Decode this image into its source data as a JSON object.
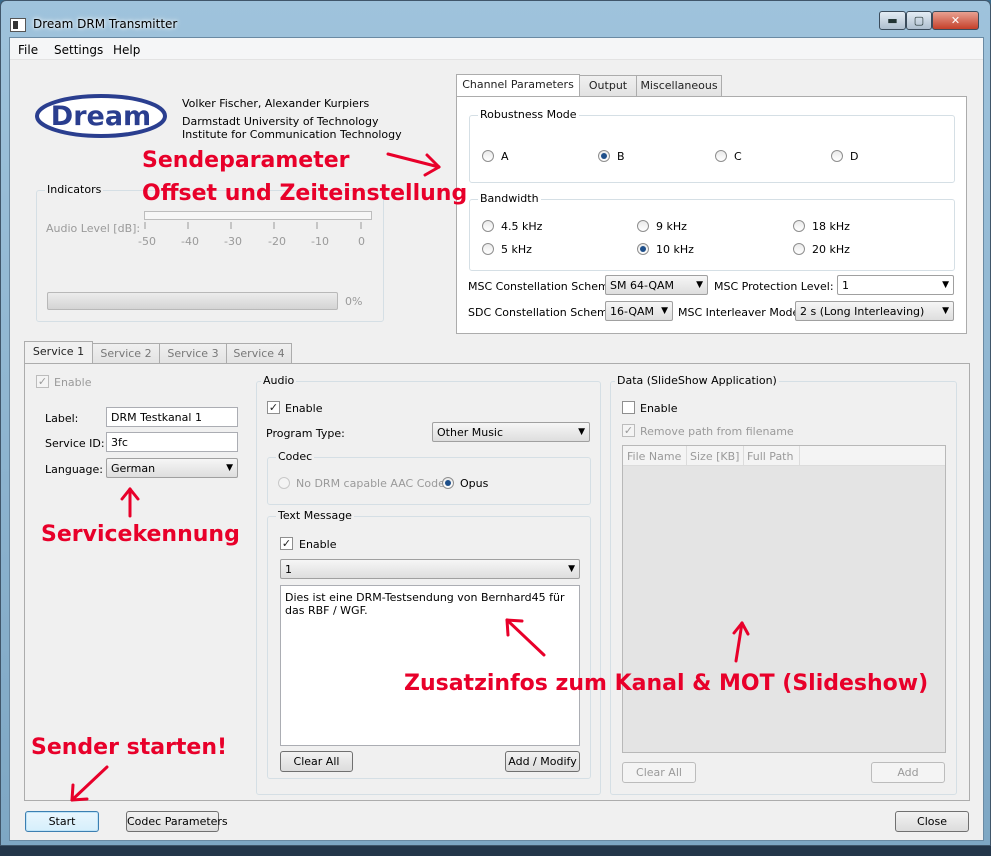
{
  "window": {
    "title": "Dream DRM Transmitter",
    "min": "▬",
    "max": "▢",
    "close": "✕"
  },
  "menu": [
    "File",
    "Settings",
    "Help"
  ],
  "header": {
    "logo": "Dream",
    "authors": "Volker Fischer, Alexander Kurpiers",
    "org1": "Darmstadt University of Technology",
    "org2": "Institute for Communication Technology"
  },
  "indicators": {
    "title": "Indicators",
    "audio_level_label": "Audio Level [dB]:",
    "scale": [
      "-50",
      "-40",
      "-30",
      "-20",
      "-10",
      "0"
    ],
    "progress_value": 0,
    "progress_text": "0%"
  },
  "channel_tabs": [
    "Channel Parameters",
    "Output",
    "Miscellaneous"
  ],
  "robustness": {
    "title": "Robustness Mode",
    "options": [
      "A",
      "B",
      "C",
      "D"
    ],
    "selected": "B"
  },
  "bandwidth": {
    "title": "Bandwidth",
    "options": [
      "4.5 kHz",
      "9 kHz",
      "18 kHz",
      "5 kHz",
      "10 kHz",
      "20 kHz"
    ],
    "selected": "10 kHz"
  },
  "params": {
    "msc_const_label": "MSC Constellation Scheme:",
    "msc_const_value": "SM 64-QAM",
    "msc_prot_label": "MSC Protection Level:",
    "msc_prot_value": "1",
    "sdc_const_label": "SDC Constellation Scheme:",
    "sdc_const_value": "16-QAM",
    "msc_inter_label": "MSC Interleaver Mode:",
    "msc_inter_value": "2 s (Long Interleaving)"
  },
  "service_tabs": [
    "Service 1",
    "Service 2",
    "Service 3",
    "Service 4"
  ],
  "service": {
    "enable_label": "Enable",
    "label_label": "Label:",
    "label_value": "DRM Testkanal 1",
    "id_label": "Service ID:",
    "id_value": "3fc",
    "lang_label": "Language:",
    "lang_value": "German"
  },
  "audio": {
    "title": "Audio",
    "enable_label": "Enable",
    "program_type_label": "Program Type:",
    "program_type_value": "Other Music",
    "codec_title": "Codec",
    "codec_opt1": "No DRM capable AAC Codec",
    "codec_opt2": "Opus",
    "text_title": "Text Message",
    "text_enable_label": "Enable",
    "text_select": "1",
    "text_message": "Dies ist eine DRM-Testsendung von Bernhard45 für das RBF / WGF.",
    "clear_all": "Clear All",
    "add_modify": "Add / Modify"
  },
  "data": {
    "title": "Data (SlideShow Application)",
    "enable_label": "Enable",
    "remove_path_label": "Remove path from filename",
    "columns": [
      "File Name",
      "Size [KB]",
      "Full Path"
    ],
    "clear_all": "Clear All",
    "add": "Add"
  },
  "footer": {
    "start": "Start",
    "codec_params": "Codec Parameters",
    "close": "Close"
  },
  "annotations": {
    "sendeparameter": "Sendeparameter",
    "offset": "Offset und Zeiteinstellung",
    "servicekennung": "Servicekennung",
    "zusatzinfos": "Zusatzinfos zum Kanal & MOT (Slideshow)",
    "sender": "Sender starten!"
  },
  "colors": {
    "annotation": "#e8002a",
    "logo_blue": "#2a3e8f"
  }
}
